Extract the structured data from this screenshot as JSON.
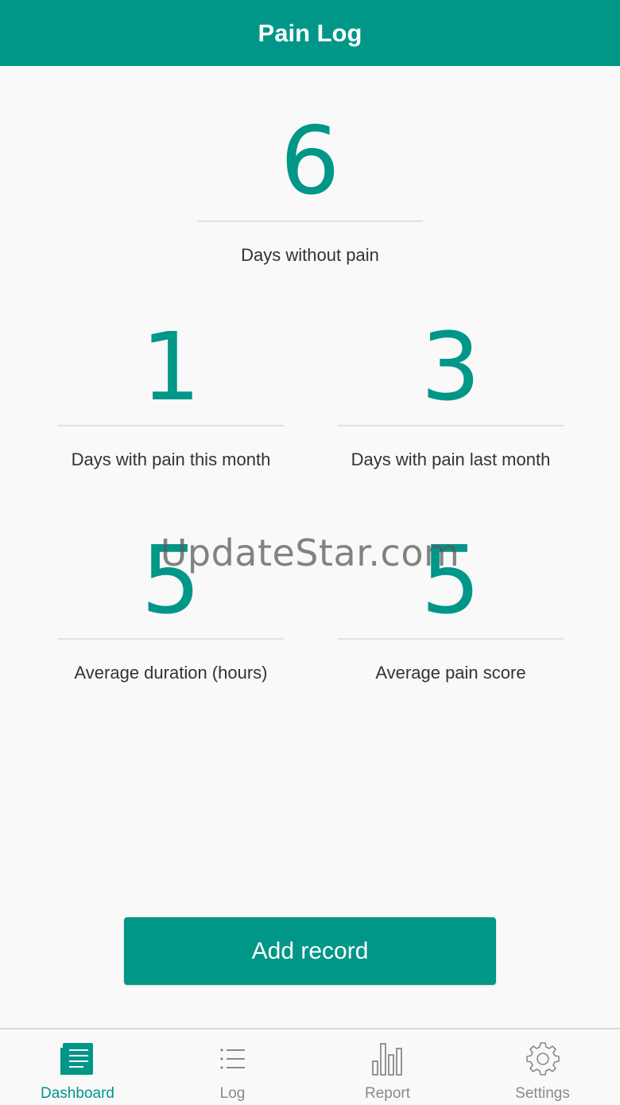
{
  "app_bar": {
    "title": "Pain Log"
  },
  "stats": {
    "days_without_pain": {
      "value": "6",
      "label": "Days without pain"
    },
    "days_pain_this_month": {
      "value": "1",
      "label": "Days with pain this month"
    },
    "days_pain_last_month": {
      "value": "3",
      "label": "Days with pain last month"
    },
    "avg_duration": {
      "value": "5",
      "label": "Average duration (hours)"
    },
    "avg_pain_score": {
      "value": "5",
      "label": "Average pain score"
    }
  },
  "watermark": "UpdateStar.com",
  "add_button": {
    "label": "Add record"
  },
  "bottom_nav": {
    "items": [
      {
        "label": "Dashboard",
        "icon": "dashboard-icon",
        "active": true
      },
      {
        "label": "Log",
        "icon": "list-icon",
        "active": false
      },
      {
        "label": "Report",
        "icon": "bar-chart-icon",
        "active": false
      },
      {
        "label": "Settings",
        "icon": "gear-icon",
        "active": false
      }
    ]
  },
  "colors": {
    "primary": "#009688",
    "inactive": "#8a8a8a",
    "background": "#f9f9f9"
  }
}
